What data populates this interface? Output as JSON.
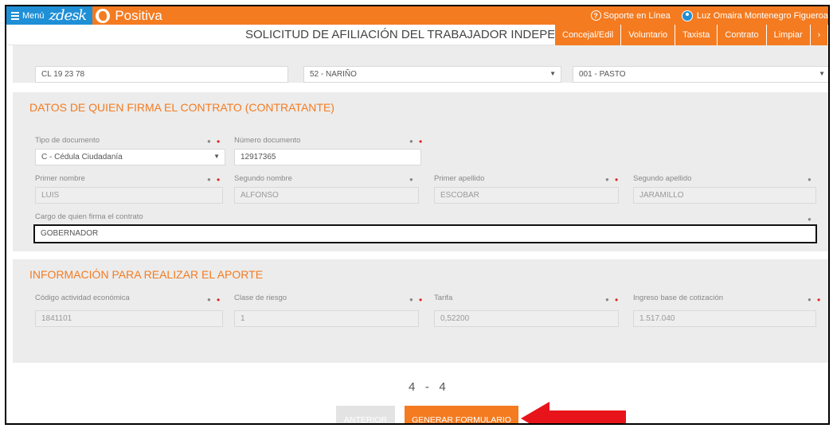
{
  "topbar": {
    "menu_label": "Menú",
    "logo": "zdesk",
    "brand": "Positiva",
    "support_label": "Soporte en Línea",
    "user_name": "Luz Omaira Montenegro Figueroa"
  },
  "title": "SOLICITUD DE AFILIACIÓN DEL TRABAJADOR INDEPENDIE",
  "actions": [
    "Concejal/Edil",
    "Voluntario",
    "Taxista",
    "Contrato",
    "Limpiar",
    "›"
  ],
  "address": {
    "direccion": "CL 19 23 78",
    "departamento": "52 - NARIÑO",
    "municipio": "001 - PASTO"
  },
  "contratante": {
    "section_title": "DATOS DE QUIEN FIRMA EL CONTRATO (CONTRATANTE)",
    "tipo_doc_label": "Tipo de documento",
    "tipo_doc_value": "C - Cédula Ciudadanía",
    "num_doc_label": "Número documento",
    "num_doc_value": "12917365",
    "primer_nombre_label": "Primer nombre",
    "primer_nombre_value": "LUIS",
    "segundo_nombre_label": "Segundo nombre",
    "segundo_nombre_value": "ALFONSO",
    "primer_apellido_label": "Primer apellido",
    "primer_apellido_value": "ESCOBAR",
    "segundo_apellido_label": "Segundo apellido",
    "segundo_apellido_value": "JARAMILLO",
    "cargo_label": "Cargo de quien firma el contrato",
    "cargo_value": "GOBERNADOR"
  },
  "aporte": {
    "section_title": "INFORMACIÓN PARA REALIZAR EL APORTE",
    "actividad_label": "Código actividad económica",
    "actividad_value": "1841101",
    "riesgo_label": "Clase de riesgo",
    "riesgo_value": "1",
    "tarifa_label": "Tarifa",
    "tarifa_value": "0,52200",
    "ibc_label": "Ingreso base de cotización",
    "ibc_value": "1.517.040"
  },
  "pager": {
    "current": "4",
    "separator": "-",
    "total": "4"
  },
  "buttons": {
    "prev": "ANTERIOR",
    "generate": "GENERAR FORMULARIO"
  },
  "colors": {
    "accent": "#f47b20",
    "blue": "#1f8fd6",
    "required": "#e02020",
    "arrow": "#e8141b"
  }
}
